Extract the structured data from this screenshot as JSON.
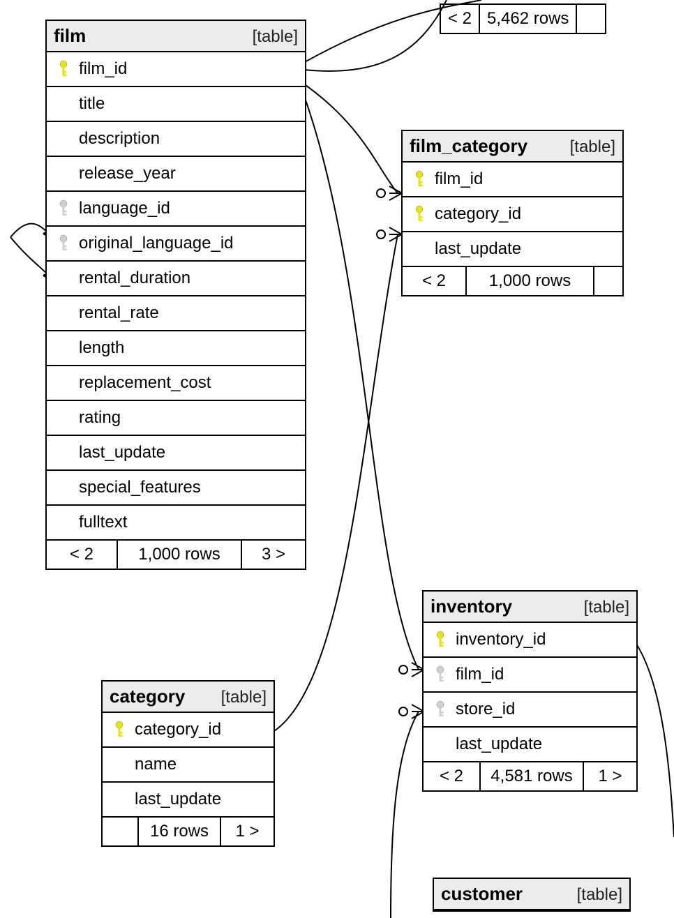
{
  "type_label": "[table]",
  "tables": {
    "film": {
      "name": "film",
      "columns": [
        {
          "name": "film_id",
          "key": "pk"
        },
        {
          "name": "title",
          "key": null
        },
        {
          "name": "description",
          "key": null
        },
        {
          "name": "release_year",
          "key": null
        },
        {
          "name": "language_id",
          "key": "fk"
        },
        {
          "name": "original_language_id",
          "key": "fk"
        },
        {
          "name": "rental_duration",
          "key": null
        },
        {
          "name": "rental_rate",
          "key": null
        },
        {
          "name": "length",
          "key": null
        },
        {
          "name": "replacement_cost",
          "key": null
        },
        {
          "name": "rating",
          "key": null
        },
        {
          "name": "last_update",
          "key": null
        },
        {
          "name": "special_features",
          "key": null
        },
        {
          "name": "fulltext",
          "key": null
        }
      ],
      "footer": {
        "left": "< 2",
        "mid": "1,000 rows",
        "right": "3 >"
      }
    },
    "film_category": {
      "name": "film_category",
      "columns": [
        {
          "name": "film_id",
          "key": "pk"
        },
        {
          "name": "category_id",
          "key": "pk"
        },
        {
          "name": "last_update",
          "key": null
        }
      ],
      "footer": {
        "left": "< 2",
        "mid": "1,000 rows",
        "right": ""
      }
    },
    "category": {
      "name": "category",
      "columns": [
        {
          "name": "category_id",
          "key": "pk"
        },
        {
          "name": "name",
          "key": null
        },
        {
          "name": "last_update",
          "key": null
        }
      ],
      "footer": {
        "left": "",
        "mid": "16 rows",
        "right": "1 >"
      }
    },
    "inventory": {
      "name": "inventory",
      "columns": [
        {
          "name": "inventory_id",
          "key": "pk"
        },
        {
          "name": "film_id",
          "key": "fk"
        },
        {
          "name": "store_id",
          "key": "fk"
        },
        {
          "name": "last_update",
          "key": null
        }
      ],
      "footer": {
        "left": "< 2",
        "mid": "4,581 rows",
        "right": "1 >"
      }
    },
    "customer": {
      "name": "customer"
    }
  },
  "top_stats": {
    "left": "< 2",
    "mid": "5,462 rows",
    "right": ""
  }
}
